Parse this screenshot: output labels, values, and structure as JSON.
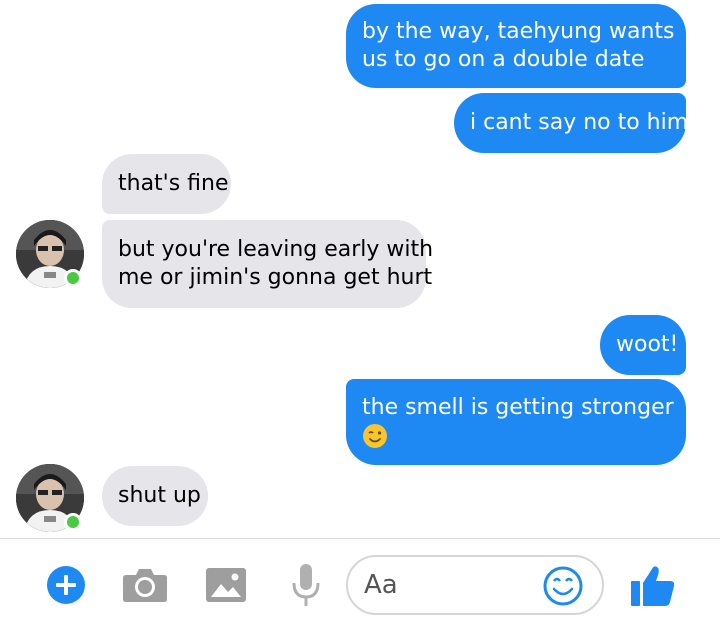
{
  "messages": [
    {
      "lines": [
        "by the way, taehyung wants",
        "us to go on a double date"
      ]
    },
    {
      "lines": [
        "i cant say no to him"
      ]
    },
    {
      "lines": [
        "that's fine"
      ]
    },
    {
      "lines": [
        "but you're leaving early with",
        "me or jimin's gonna get hurt"
      ]
    },
    {
      "lines": [
        "woot!"
      ]
    },
    {
      "lines": [
        "the smell is getting stronger"
      ]
    },
    {
      "lines": [
        "shut up"
      ]
    }
  ],
  "composer": {
    "placeholder": "Aa",
    "icons": [
      "plus-icon",
      "camera-icon",
      "image-icon",
      "microphone-icon",
      "emoji-icon",
      "thumbs-up-icon"
    ]
  },
  "colors": {
    "outgoing_bubble": "#1e88f3",
    "incoming_bubble": "#e5e5ea",
    "accent": "#1e88f3",
    "online_dot": "#4ac942",
    "toolbar_icon_gray": "#9e9e9e"
  }
}
